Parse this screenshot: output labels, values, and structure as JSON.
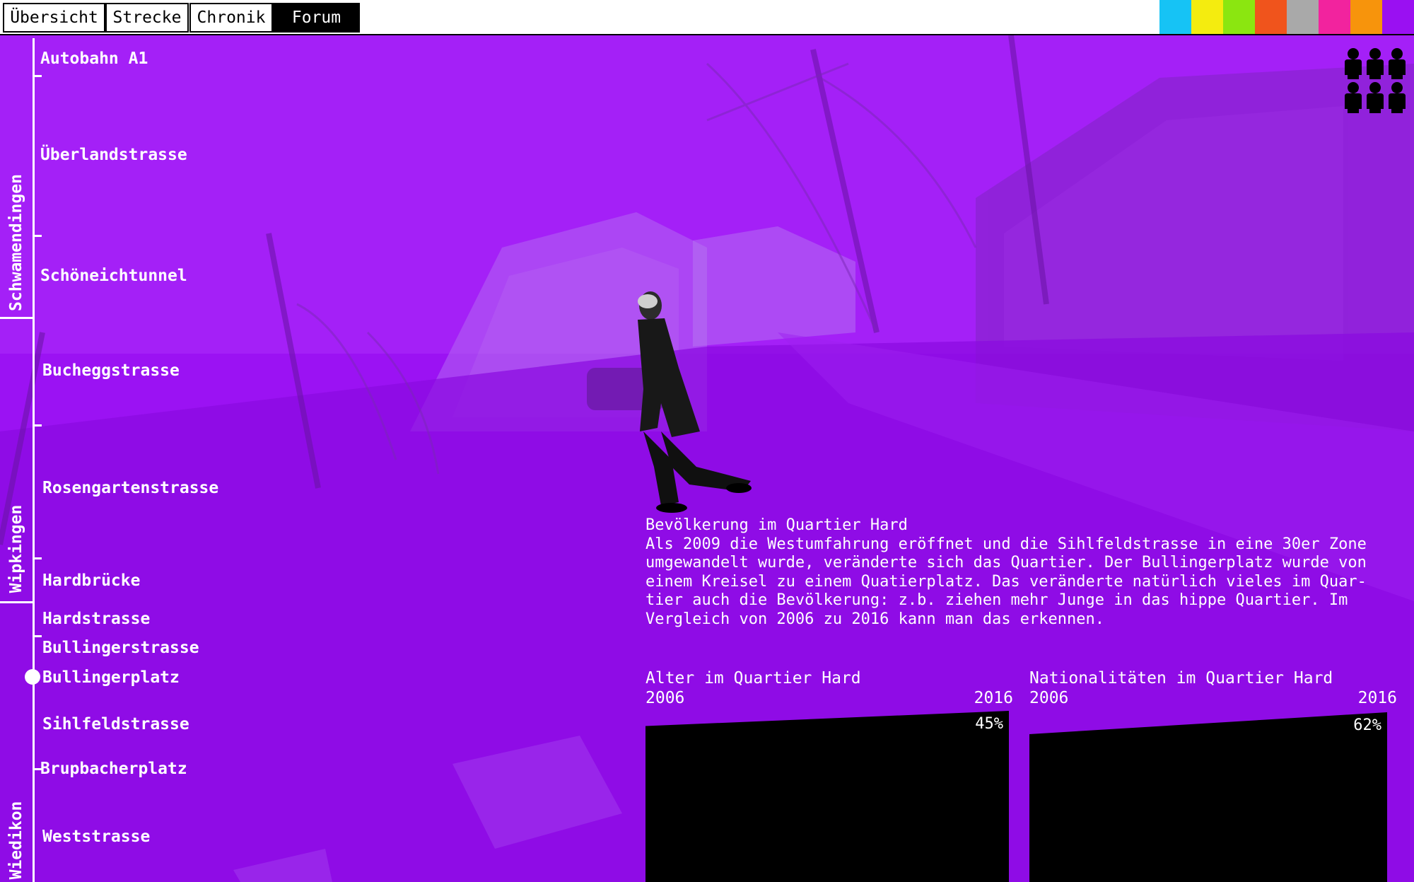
{
  "nav": {
    "tabs": [
      {
        "label": "Übersicht",
        "active": false
      },
      {
        "label": "Strecke",
        "active": false
      },
      {
        "label": "Chronik",
        "active": false
      },
      {
        "label": "Forum",
        "active": true
      }
    ]
  },
  "palette": [
    "#16c3f5",
    "#f4ec0f",
    "#8be610",
    "#f0541c",
    "#a9a9a9",
    "#f2239e",
    "#f7940c",
    "#9a10f2"
  ],
  "timeline": {
    "districts": [
      "Schwamendingen",
      "Wipkingen",
      "Wiedikon"
    ],
    "stops": [
      {
        "label": "Autobahn A1"
      },
      {
        "label": "Überlandstrasse"
      },
      {
        "label": "Schöneichtunnel"
      },
      {
        "label": "Bucheggstrasse"
      },
      {
        "label": "Rosengartenstrasse"
      },
      {
        "label": "Hardbrücke"
      },
      {
        "label": "Hardstrasse"
      },
      {
        "label": "Bullingerstrasse"
      },
      {
        "label": "Bullingerplatz",
        "current": true
      },
      {
        "label": "Sihlfeldstrasse"
      },
      {
        "label": "Brupbacherplatz"
      },
      {
        "label": "Weststrasse"
      }
    ]
  },
  "info": {
    "title": "Bevölkerung im Quartier Hard",
    "lines": [
      "Als 2009 die Westumfahrung eröffnet und die Sihlfeldstrasse in eine 30er Zone",
      "umgewandelt wurde, veränderte sich das Quartier. Der Bullingerplatz wurde von",
      "einem Kreisel zu einem Quatierplatz. Das veränderte natürlich vieles im Quar-",
      "tier auch die Bevölkerung: z.b. ziehen mehr Junge in das hippe Quartier. Im",
      "Vergleich von 2006 zu 2016 kann man das erkennen."
    ]
  },
  "chart_data": [
    {
      "type": "area",
      "title": "Alter im Quartier Hard",
      "x": [
        "2006",
        "2016"
      ],
      "values": [
        41,
        45
      ],
      "data_labels": [
        "",
        "45%"
      ],
      "ylim": [
        0,
        45
      ]
    },
    {
      "type": "area",
      "title": "Nationalitäten im Quartier Hard",
      "x": [
        "2006",
        "2016"
      ],
      "values": [
        54,
        62
      ],
      "data_labels": [
        "",
        "62%"
      ],
      "ylim": [
        0,
        62
      ]
    }
  ]
}
